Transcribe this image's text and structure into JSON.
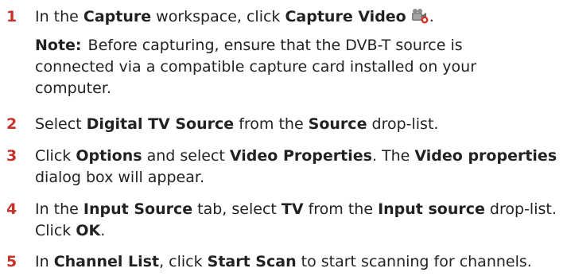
{
  "steps": [
    {
      "number": "1",
      "parts": [
        "In the ",
        "Capture",
        " workspace, click ",
        "Capture Video",
        "."
      ],
      "note": {
        "label": "Note:",
        "lines": [
          "Before capturing, ensure that the DVB-T source is",
          "connected via a compatible capture card installed on your",
          "computer."
        ]
      },
      "icon": "capture-video-icon"
    },
    {
      "number": "2",
      "parts": [
        "Select ",
        "Digital TV Source",
        " from the ",
        "Source",
        " drop-list."
      ]
    },
    {
      "number": "3",
      "line1": [
        "Click ",
        "Options",
        " and select ",
        "Video Properties",
        ". The ",
        "Video properties"
      ],
      "line2": "dialog box will appear."
    },
    {
      "number": "4",
      "line1": [
        "In the ",
        "Input Source",
        " tab, select ",
        "TV",
        " from the ",
        "Input source",
        " drop-list."
      ],
      "line2": [
        "Click ",
        "OK",
        "."
      ]
    },
    {
      "number": "5",
      "parts": [
        "In ",
        "Channel List",
        ", click ",
        "Start Scan",
        " to start scanning for channels."
      ]
    }
  ],
  "colors": {
    "step_number": "#c8302a",
    "text": "#222222"
  }
}
